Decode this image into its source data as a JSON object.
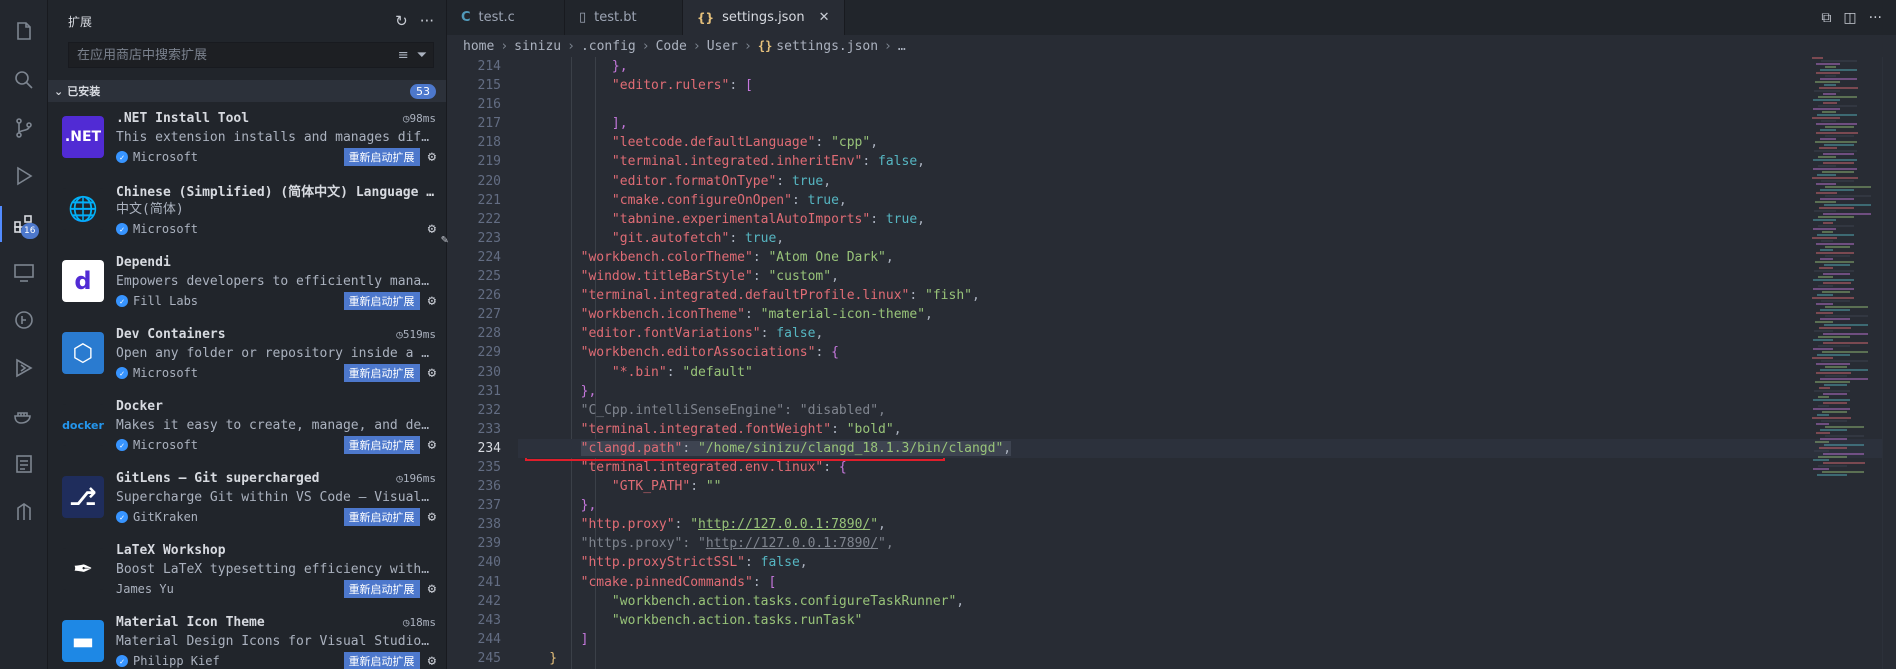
{
  "activity": {
    "items": [
      {
        "name": "explorer-icon"
      },
      {
        "name": "search-icon"
      },
      {
        "name": "source-control-icon"
      },
      {
        "name": "run-debug-icon"
      },
      {
        "name": "extensions-icon",
        "badge": "16",
        "active": true
      },
      {
        "name": "remote-explorer-icon"
      },
      {
        "name": "gitlens-icon"
      },
      {
        "name": "testing-icon"
      },
      {
        "name": "docker-icon"
      },
      {
        "name": "tasks-icon"
      },
      {
        "name": "git-graph-icon"
      }
    ]
  },
  "sidebar": {
    "title": "扩展",
    "search_placeholder": "在应用商店中搜索扩展",
    "section_label": "已安装",
    "section_count": "53",
    "extensions": [
      {
        "name": ".NET Install Tool",
        "time": "98ms",
        "desc": "This extension installs and manages different versions of the .NET SDK and Runtime.",
        "publisher": "Microsoft",
        "verified": true,
        "restart": "重新启动扩展",
        "icon_text": ".NET",
        "icon_bg": "#512bd4"
      },
      {
        "name": "Chinese (Simplified) (简体中文) Language Pack for Visual Studio Code",
        "time": "",
        "desc": "中文(简体)",
        "publisher": "Microsoft",
        "verified": true,
        "restart": "",
        "icon_text": "🌐",
        "icon_bg": "#21252b"
      },
      {
        "name": "Dependi",
        "time": "",
        "desc": "Empowers developers to efficiently manage dependencies",
        "publisher": "Fill Labs",
        "verified": true,
        "restart": "重新启动扩展",
        "icon_text": "d",
        "icon_bg": "#ffffff"
      },
      {
        "name": "Dev Containers",
        "time": "519ms",
        "desc": "Open any folder or repository inside a Docker container",
        "publisher": "Microsoft",
        "verified": true,
        "restart": "重新启动扩展",
        "icon_text": "⬡",
        "icon_bg": "#2a7bd0"
      },
      {
        "name": "Docker",
        "time": "",
        "desc": "Makes it easy to create, manage, and debug containerized applications.",
        "publisher": "Microsoft",
        "verified": true,
        "restart": "重新启动扩展",
        "icon_text": "docker",
        "icon_bg": "#21252b"
      },
      {
        "name": "GitLens — Git supercharged",
        "time": "196ms",
        "desc": "Supercharge Git within VS Code — Visualize code authorship",
        "publisher": "GitKraken",
        "verified": true,
        "restart": "重新启动扩展",
        "icon_text": "⎇",
        "icon_bg": "#1f2d5c"
      },
      {
        "name": "LaTeX Workshop",
        "time": "",
        "desc": "Boost LaTeX typesetting efficiency with preview, compile",
        "publisher": "James Yu",
        "verified": false,
        "restart": "重新启动扩展",
        "icon_text": "✒",
        "icon_bg": "#21252b"
      },
      {
        "name": "Material Icon Theme",
        "time": "18ms",
        "desc": "Material Design Icons for Visual Studio Code",
        "publisher": "Philipp Kief",
        "verified": true,
        "restart": "重新启动扩展",
        "icon_text": "▬",
        "icon_bg": "#1e88e5"
      }
    ]
  },
  "tabs": [
    {
      "label": "test.c",
      "icon": "c",
      "active": false
    },
    {
      "label": "test.bt",
      "icon": "file",
      "active": false
    },
    {
      "label": "settings.json",
      "icon": "json",
      "active": true
    }
  ],
  "breadcrumb": [
    "home",
    "sinizu",
    ".config",
    "Code",
    "User",
    "settings.json",
    "…"
  ],
  "editor": {
    "current_line": "234",
    "lines": [
      {
        "n": "214",
        "t": [
          {
            "c": "br2",
            "v": "            },"
          }
        ]
      },
      {
        "n": "215",
        "t": [
          {
            "c": "p",
            "v": "            "
          },
          {
            "c": "k",
            "v": "\"editor.rulers\""
          },
          {
            "c": "p",
            "v": ": "
          },
          {
            "c": "br2",
            "v": "["
          }
        ]
      },
      {
        "n": "216",
        "t": [
          {
            "c": "p",
            "v": ""
          }
        ]
      },
      {
        "n": "217",
        "t": [
          {
            "c": "br2",
            "v": "            ],"
          }
        ]
      },
      {
        "n": "218",
        "t": [
          {
            "c": "p",
            "v": "            "
          },
          {
            "c": "k",
            "v": "\"leetcode.defaultLanguage\""
          },
          {
            "c": "p",
            "v": ": "
          },
          {
            "c": "s",
            "v": "\"cpp\""
          },
          {
            "c": "p",
            "v": ","
          }
        ]
      },
      {
        "n": "219",
        "t": [
          {
            "c": "p",
            "v": "            "
          },
          {
            "c": "k",
            "v": "\"terminal.integrated.inheritEnv\""
          },
          {
            "c": "p",
            "v": ": "
          },
          {
            "c": "b",
            "v": "false"
          },
          {
            "c": "p",
            "v": ","
          }
        ]
      },
      {
        "n": "220",
        "t": [
          {
            "c": "p",
            "v": "            "
          },
          {
            "c": "k",
            "v": "\"editor.formatOnType\""
          },
          {
            "c": "p",
            "v": ": "
          },
          {
            "c": "b",
            "v": "true"
          },
          {
            "c": "p",
            "v": ","
          }
        ]
      },
      {
        "n": "221",
        "t": [
          {
            "c": "p",
            "v": "            "
          },
          {
            "c": "k",
            "v": "\"cmake.configureOnOpen\""
          },
          {
            "c": "p",
            "v": ": "
          },
          {
            "c": "b",
            "v": "true"
          },
          {
            "c": "p",
            "v": ","
          }
        ]
      },
      {
        "n": "222",
        "t": [
          {
            "c": "p",
            "v": "            "
          },
          {
            "c": "k",
            "v": "\"tabnine.experimentalAutoImports\""
          },
          {
            "c": "p",
            "v": ": "
          },
          {
            "c": "b",
            "v": "true"
          },
          {
            "c": "p",
            "v": ","
          }
        ]
      },
      {
        "n": "223",
        "t": [
          {
            "c": "p",
            "v": "            "
          },
          {
            "c": "k",
            "v": "\"git.autofetch\""
          },
          {
            "c": "p",
            "v": ": "
          },
          {
            "c": "b",
            "v": "true"
          },
          {
            "c": "p",
            "v": ","
          }
        ]
      },
      {
        "n": "224",
        "t": [
          {
            "c": "p",
            "v": "        "
          },
          {
            "c": "k",
            "v": "\"workbench.colorTheme\""
          },
          {
            "c": "p",
            "v": ": "
          },
          {
            "c": "s",
            "v": "\"Atom One Dark\""
          },
          {
            "c": "p",
            "v": ","
          }
        ]
      },
      {
        "n": "225",
        "t": [
          {
            "c": "p",
            "v": "        "
          },
          {
            "c": "k",
            "v": "\"window.titleBarStyle\""
          },
          {
            "c": "p",
            "v": ": "
          },
          {
            "c": "s",
            "v": "\"custom\""
          },
          {
            "c": "p",
            "v": ","
          }
        ]
      },
      {
        "n": "226",
        "t": [
          {
            "c": "p",
            "v": "        "
          },
          {
            "c": "k",
            "v": "\"terminal.integrated.defaultProfile.linux\""
          },
          {
            "c": "p",
            "v": ": "
          },
          {
            "c": "s",
            "v": "\"fish\""
          },
          {
            "c": "p",
            "v": ","
          }
        ]
      },
      {
        "n": "227",
        "t": [
          {
            "c": "p",
            "v": "        "
          },
          {
            "c": "k",
            "v": "\"workbench.iconTheme\""
          },
          {
            "c": "p",
            "v": ": "
          },
          {
            "c": "s",
            "v": "\"material-icon-theme\""
          },
          {
            "c": "p",
            "v": ","
          }
        ]
      },
      {
        "n": "228",
        "t": [
          {
            "c": "p",
            "v": "        "
          },
          {
            "c": "k",
            "v": "\"editor.fontVariations\""
          },
          {
            "c": "p",
            "v": ": "
          },
          {
            "c": "b",
            "v": "false"
          },
          {
            "c": "p",
            "v": ","
          }
        ]
      },
      {
        "n": "229",
        "t": [
          {
            "c": "p",
            "v": "        "
          },
          {
            "c": "k",
            "v": "\"workbench.editorAssociations\""
          },
          {
            "c": "p",
            "v": ": "
          },
          {
            "c": "br2",
            "v": "{"
          }
        ]
      },
      {
        "n": "230",
        "t": [
          {
            "c": "p",
            "v": "            "
          },
          {
            "c": "k",
            "v": "\"*.bin\""
          },
          {
            "c": "p",
            "v": ": "
          },
          {
            "c": "s",
            "v": "\"default\""
          }
        ]
      },
      {
        "n": "231",
        "t": [
          {
            "c": "br2",
            "v": "        },"
          }
        ]
      },
      {
        "n": "232",
        "t": [
          {
            "c": "p",
            "v": "        "
          },
          {
            "c": "dim",
            "v": "\"C_Cpp.intelliSenseEngine\": \"disabled\","
          }
        ]
      },
      {
        "n": "233",
        "t": [
          {
            "c": "p",
            "v": "        "
          },
          {
            "c": "k",
            "v": "\"terminal.integrated.fontWeight\""
          },
          {
            "c": "p",
            "v": ": "
          },
          {
            "c": "s",
            "v": "\"bold\""
          },
          {
            "c": "p",
            "v": ","
          }
        ]
      },
      {
        "n": "234",
        "t": [
          {
            "c": "p",
            "v": "        "
          },
          {
            "c": "k sel",
            "v": "\"clangd.path\""
          },
          {
            "c": "p sel",
            "v": ": "
          },
          {
            "c": "s sel",
            "v": "\"/home/sinizu/clangd_18.1.3/bin/clangd\""
          },
          {
            "c": "p sel",
            "v": ","
          }
        ]
      },
      {
        "n": "235",
        "t": [
          {
            "c": "p",
            "v": "        "
          },
          {
            "c": "k",
            "v": "\"terminal.integrated.env.linux\""
          },
          {
            "c": "p",
            "v": ": "
          },
          {
            "c": "br2",
            "v": "{"
          }
        ]
      },
      {
        "n": "236",
        "t": [
          {
            "c": "p",
            "v": "            "
          },
          {
            "c": "k",
            "v": "\"GTK_PATH\""
          },
          {
            "c": "p",
            "v": ": "
          },
          {
            "c": "s",
            "v": "\"\""
          }
        ]
      },
      {
        "n": "237",
        "t": [
          {
            "c": "br2",
            "v": "        },"
          }
        ]
      },
      {
        "n": "238",
        "t": [
          {
            "c": "p",
            "v": "        "
          },
          {
            "c": "k",
            "v": "\"http.proxy\""
          },
          {
            "c": "p",
            "v": ": "
          },
          {
            "c": "s",
            "v": "\""
          },
          {
            "c": "s und",
            "v": "http://127.0.0.1:7890/"
          },
          {
            "c": "s",
            "v": "\""
          },
          {
            "c": "p",
            "v": ","
          }
        ]
      },
      {
        "n": "239",
        "t": [
          {
            "c": "p",
            "v": "        "
          },
          {
            "c": "dim",
            "v": "\"https.proxy\": \""
          },
          {
            "c": "dim und",
            "v": "http://127.0.0.1:7890/"
          },
          {
            "c": "dim",
            "v": "\","
          }
        ]
      },
      {
        "n": "240",
        "t": [
          {
            "c": "p",
            "v": "        "
          },
          {
            "c": "k",
            "v": "\"http.proxyStrictSSL\""
          },
          {
            "c": "p",
            "v": ": "
          },
          {
            "c": "b",
            "v": "false"
          },
          {
            "c": "p",
            "v": ","
          }
        ]
      },
      {
        "n": "241",
        "t": [
          {
            "c": "p",
            "v": "        "
          },
          {
            "c": "k",
            "v": "\"cmake.pinnedCommands\""
          },
          {
            "c": "p",
            "v": ": "
          },
          {
            "c": "br2",
            "v": "["
          }
        ]
      },
      {
        "n": "242",
        "t": [
          {
            "c": "p",
            "v": "            "
          },
          {
            "c": "s",
            "v": "\"workbench.action.tasks.configureTaskRunner\""
          },
          {
            "c": "p",
            "v": ","
          }
        ]
      },
      {
        "n": "243",
        "t": [
          {
            "c": "p",
            "v": "            "
          },
          {
            "c": "s",
            "v": "\"workbench.action.tasks.runTask\""
          }
        ]
      },
      {
        "n": "244",
        "t": [
          {
            "c": "br2",
            "v": "        ]"
          }
        ]
      },
      {
        "n": "245",
        "t": [
          {
            "c": "br1",
            "v": "    }"
          }
        ]
      }
    ]
  }
}
